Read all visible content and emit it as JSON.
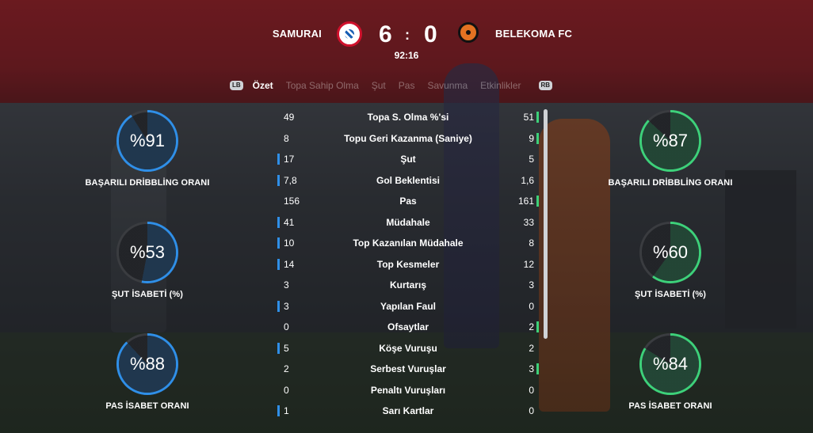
{
  "header": {
    "home_team": "SAMURAI",
    "away_team": "BELEKOMA FC",
    "home_score": "6",
    "separator": ":",
    "away_score": "0",
    "clock": "92:16"
  },
  "tabs": {
    "left_bumper": "LB",
    "right_bumper": "RB",
    "items": [
      "Özet",
      "Topa Sahip Olma",
      "Şut",
      "Pas",
      "Savunma",
      "Etkinlikler"
    ],
    "active": "Özet"
  },
  "home_rings": [
    {
      "value": "%91",
      "label": "BAŞARILI DRİBBLİNG ORANI",
      "fraction": 0.91
    },
    {
      "value": "%53",
      "label": "ŞUT İSABETİ (%)",
      "fraction": 0.53
    },
    {
      "value": "%88",
      "label": "PAS İSABET ORANI",
      "fraction": 0.88
    }
  ],
  "away_rings": [
    {
      "value": "%87",
      "label": "BAŞARILI DRİBBLİNG ORANI",
      "fraction": 0.87
    },
    {
      "value": "%60",
      "label": "ŞUT İSABETİ (%)",
      "fraction": 0.6
    },
    {
      "value": "%84",
      "label": "PAS İSABET ORANI",
      "fraction": 0.84
    }
  ],
  "stats": [
    {
      "label": "Topa S. Olma %'si",
      "home": "49",
      "away": "51",
      "leader": "away"
    },
    {
      "label": "Topu Geri Kazanma (Saniye)",
      "home": "8",
      "away": "9",
      "leader": "away"
    },
    {
      "label": "Şut",
      "home": "17",
      "away": "5",
      "leader": "home"
    },
    {
      "label": "Gol Beklentisi",
      "home": "7,8",
      "away": "1,6",
      "leader": "home"
    },
    {
      "label": "Pas",
      "home": "156",
      "away": "161",
      "leader": "away"
    },
    {
      "label": "Müdahale",
      "home": "41",
      "away": "33",
      "leader": "home"
    },
    {
      "label": "Top Kazanılan Müdahale",
      "home": "10",
      "away": "8",
      "leader": "home"
    },
    {
      "label": "Top Kesmeler",
      "home": "14",
      "away": "12",
      "leader": "home"
    },
    {
      "label": "Kurtarış",
      "home": "3",
      "away": "3",
      "leader": "none"
    },
    {
      "label": "Yapılan Faul",
      "home": "3",
      "away": "0",
      "leader": "home"
    },
    {
      "label": "Ofsaytlar",
      "home": "0",
      "away": "2",
      "leader": "away"
    },
    {
      "label": "Köşe Vuruşu",
      "home": "5",
      "away": "2",
      "leader": "home"
    },
    {
      "label": "Serbest Vuruşlar",
      "home": "2",
      "away": "3",
      "leader": "away"
    },
    {
      "label": "Penaltı Vuruşları",
      "home": "0",
      "away": "0",
      "leader": "none"
    },
    {
      "label": "Sarı Kartlar",
      "home": "1",
      "away": "0",
      "leader": "home"
    }
  ],
  "colors": {
    "home_accent": "#2f8fe8",
    "away_accent": "#3dd17a",
    "ring_track": "#3a3c40",
    "banner_red": "#b21e24"
  }
}
